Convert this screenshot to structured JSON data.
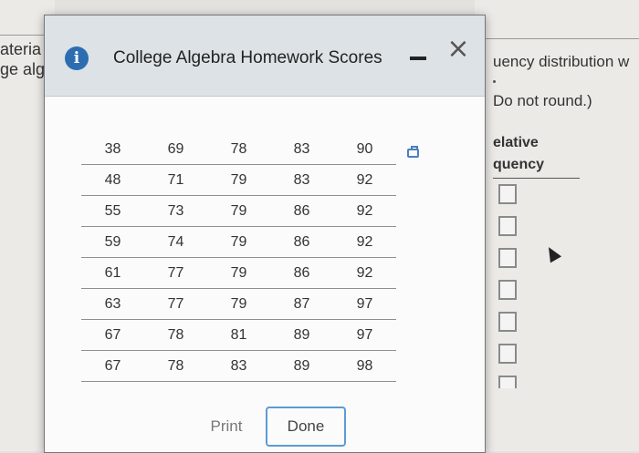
{
  "background": {
    "left_text_1": "ateria",
    "left_text_2": "ge alg",
    "right_text_1": "uency distribution w",
    "right_text_2": "Do not round.)",
    "right_header_1": "elative",
    "right_header_2": "quency"
  },
  "dialog": {
    "title": "College Algebra Homework Scores",
    "info_icon": "i",
    "close_icon": "×",
    "table": [
      [
        "38",
        "69",
        "78",
        "83",
        "90"
      ],
      [
        "48",
        "71",
        "79",
        "83",
        "92"
      ],
      [
        "55",
        "73",
        "79",
        "86",
        "92"
      ],
      [
        "59",
        "74",
        "79",
        "86",
        "92"
      ],
      [
        "61",
        "77",
        "79",
        "86",
        "92"
      ],
      [
        "63",
        "77",
        "79",
        "87",
        "97"
      ],
      [
        "67",
        "78",
        "81",
        "89",
        "97"
      ],
      [
        "67",
        "78",
        "83",
        "89",
        "98"
      ]
    ],
    "buttons": {
      "print_label": "Print",
      "done_label": "Done"
    }
  },
  "colors": {
    "info_blue": "#2c6db2",
    "focus_blue": "#5b9bd5"
  }
}
